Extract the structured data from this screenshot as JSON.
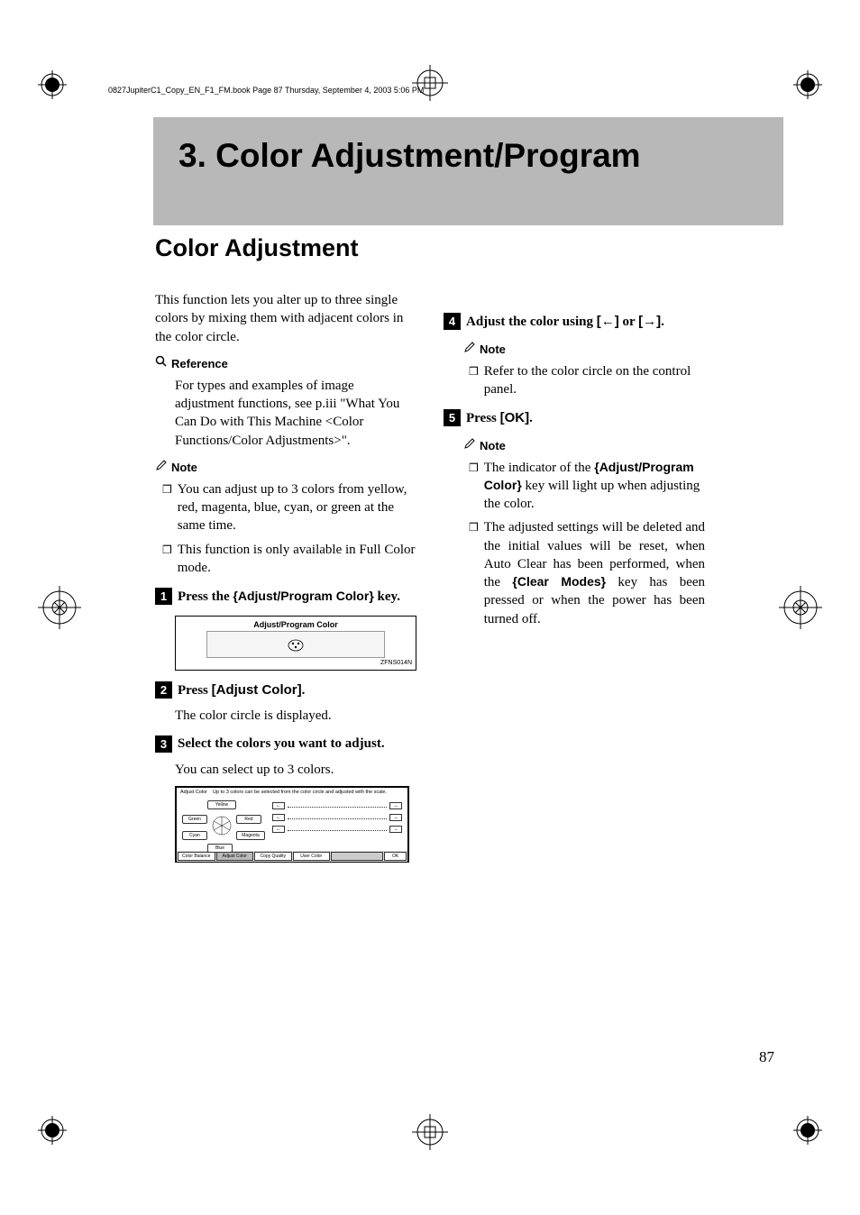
{
  "pageHeaderLine": "0827JupiterC1_Copy_EN_F1_FM.book  Page 87  Thursday, September 4, 2003  5:06 PM",
  "chapterTitle": "3. Color Adjustment/Program",
  "sectionTitle": "Color Adjustment",
  "introText": "This function lets you alter up to three single colors by mixing them with adjacent colors in the color circle.",
  "referenceLabel": "Reference",
  "referenceText": "For types and examples of image adjustment functions, see p.iii \"What You Can Do with This Machine <Color Functions/Color Adjustments>\".",
  "noteLabel1": "Note",
  "noteItem1": "You can adjust up to 3 colors from yellow, red, magenta, blue, cyan, or green at the same time.",
  "noteItem2": "This function is only available in Full Color mode.",
  "step1": {
    "prefix": "Press the ",
    "keyLabel": "Adjust/Program Color",
    "suffix": " key."
  },
  "step1ImageLabel": "Adjust/Program Color",
  "step1ImageCaption": "ZFNS014N",
  "step2": {
    "prefix": "Press ",
    "button": "[Adjust Color]",
    "suffix": "."
  },
  "step2Sub": "The color circle is displayed.",
  "step3": "Select the colors you want to adjust.",
  "step3Sub": "You can select up to 3 colors.",
  "screenshot": {
    "headerLeft": "Adjust Color",
    "headerRight": "Up to 3 colors can be selected from the color circle and adjusted with the scale.",
    "colors": {
      "yellow": "Yellow",
      "green": "Green",
      "red": "Red",
      "cyan": "Cyan",
      "magenta": "Magenta",
      "blue": "Blue"
    },
    "footer": {
      "colorBalance": "Color Balance",
      "adjustColor": "Adjust Color",
      "copyQuality": "Copy Quality",
      "userColor": "User Color",
      "ok": "OK"
    }
  },
  "step4": {
    "prefix": "Adjust the color using ",
    "left": "[←]",
    "or": " or ",
    "right": "[→]",
    "suffix": "."
  },
  "noteLabel2": "Note",
  "noteItem4": "Refer to the color circle on the control panel.",
  "step5": {
    "prefix": "Press ",
    "button": "[OK]",
    "suffix": "."
  },
  "noteLabel3": "Note",
  "noteItem5a": "The indicator of the ",
  "noteItem5aKey": "Adjust/Program Color",
  "noteItem5aSuffix": " key will light up when adjusting the color.",
  "noteItem5b": "The adjusted settings will be deleted and the initial values will be reset, when Auto Clear has been performed, when the ",
  "noteItem5bKey": "Clear Modes",
  "noteItem5bSuffix": " key has been pressed or when the power has been turned off.",
  "pageNumber": "87"
}
